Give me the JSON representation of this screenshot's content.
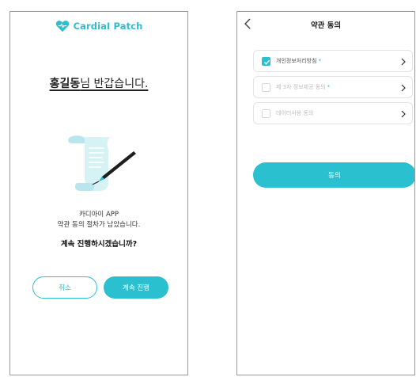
{
  "left_screen": {
    "brand": {
      "name": "CardiaI Patch",
      "icon": "heart-logo-icon"
    },
    "greeting": {
      "name": "홍길동",
      "rest": "님 반갑습니다."
    },
    "illustration": {
      "icon": "contract-scroll-pen-icon"
    },
    "description": {
      "line1": "카디아이 APP",
      "line2": "약관 동의 절차가 남았습니다."
    },
    "question": "계속 진행하시겠습니까?",
    "buttons": {
      "cancel": "취소",
      "continue": "계속 진행"
    }
  },
  "right_screen": {
    "nav": {
      "title": "약관 동의",
      "back_icon": "chevron-left-icon"
    },
    "items": [
      {
        "label": "개인정보처리방침",
        "required": "*",
        "checked": true
      },
      {
        "label": "제 3자 정보제공 동의",
        "required": "*",
        "checked": false
      },
      {
        "label": "데이터사용 동의",
        "required": "",
        "checked": false
      }
    ],
    "agree_button": "동의"
  },
  "colors": {
    "accent": "#2bc0cf",
    "border": "#e4e4e4",
    "muted_text": "#bdbdbd"
  }
}
